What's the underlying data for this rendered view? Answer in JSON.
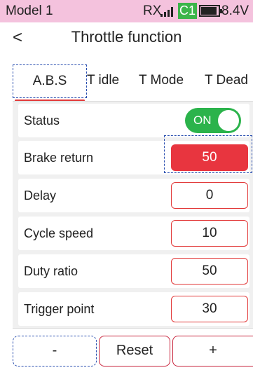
{
  "status_bar": {
    "model": "Model 1",
    "rx_label": "RX",
    "channel": "C1",
    "voltage": "8.4V",
    "signal_icon": "signal-bars-icon",
    "battery_icon": "battery-icon",
    "channel_color": "#3cb54a"
  },
  "header": {
    "back_icon": "chevron-left-icon",
    "back_glyph": "<",
    "title": "Throttle function"
  },
  "tabs": [
    {
      "label": "A.B.S",
      "active": true
    },
    {
      "label": "T idle",
      "active": false
    },
    {
      "label": "T Mode",
      "active": false
    },
    {
      "label": "T Dead",
      "active": false
    }
  ],
  "rows": {
    "status": {
      "label": "Status",
      "value": "ON"
    },
    "brake_return": {
      "label": "Brake return",
      "value": "50"
    },
    "delay": {
      "label": "Delay",
      "value": "0"
    },
    "cycle_speed": {
      "label": "Cycle speed",
      "value": "10"
    },
    "duty_ratio": {
      "label": "Duty ratio",
      "value": "50"
    },
    "trigger_point": {
      "label": "Trigger point",
      "value": "30"
    }
  },
  "bottom": {
    "minus": "-",
    "reset": "Reset",
    "plus": "+"
  },
  "colors": {
    "accent_red": "#e8353f",
    "toggle_green": "#2bb34b",
    "status_bar_bg": "#f4c2dd",
    "focus_blue": "#2a4fb0"
  }
}
